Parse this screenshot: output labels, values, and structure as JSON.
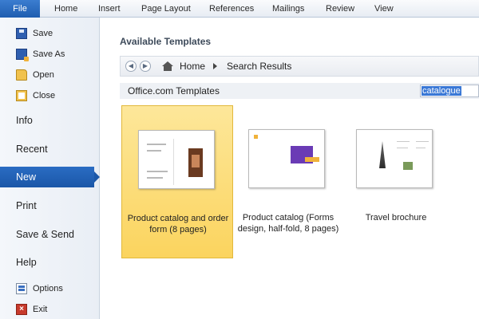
{
  "ribbon": {
    "file_tab": "File",
    "tabs": [
      "Home",
      "Insert",
      "Page Layout",
      "References",
      "Mailings",
      "Review",
      "View"
    ]
  },
  "nav": {
    "save": "Save",
    "save_as": "Save As",
    "open": "Open",
    "close": "Close",
    "info": "Info",
    "recent": "Recent",
    "new": "New",
    "print": "Print",
    "save_send": "Save & Send",
    "help": "Help",
    "options": "Options",
    "exit": "Exit"
  },
  "main": {
    "heading": "Available Templates",
    "breadcrumb": [
      "Home",
      "Search Results"
    ],
    "source_label": "Office.com Templates",
    "search_value": "catalogue"
  },
  "templates": [
    {
      "label": "Product catalog and order form (8 pages)",
      "selected": true
    },
    {
      "label": "Product catalog (Forms design, half-fold, 8 pages)",
      "selected": false
    },
    {
      "label": "Travel brochure",
      "selected": false
    }
  ],
  "colors": {
    "file_tab": "#1f5eb0",
    "nav_active": "#2a6cc3",
    "selected_card": "#fbd45e",
    "search_highlight": "#3a78d6"
  }
}
